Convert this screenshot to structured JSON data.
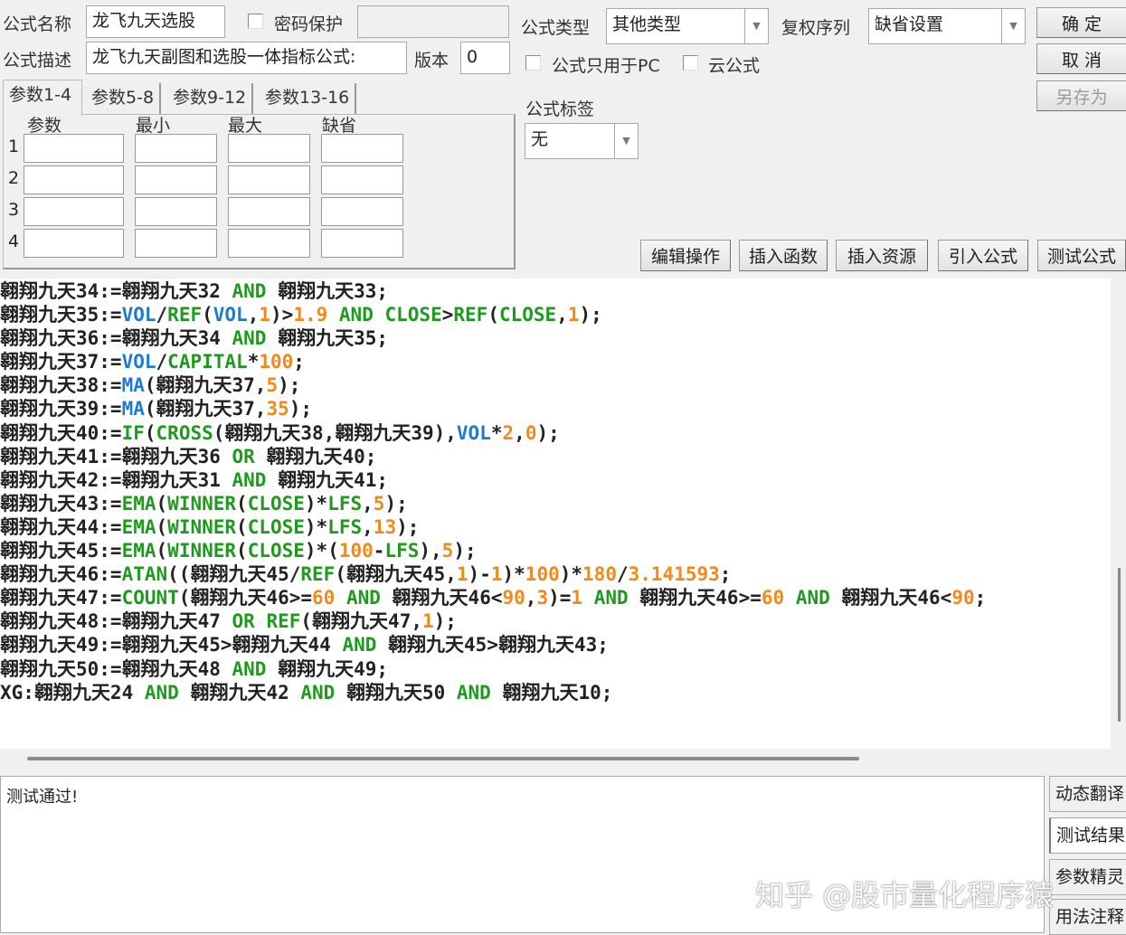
{
  "form": {
    "name_label": "公式名称",
    "name_value": "龙飞九天选股",
    "password_label": "密码保护",
    "desc_label": "公式描述",
    "desc_value": "龙飞九天副图和选股一体指标公式:",
    "version_label": "版本",
    "version_value": "0",
    "type_label": "公式类型",
    "type_value": "其他类型",
    "rights_label": "复权序列",
    "rights_value": "缺省设置",
    "pc_only_label": "公式只用于PC",
    "cloud_label": "云公式",
    "tag_label": "公式标签",
    "tag_value": "无"
  },
  "buttons": {
    "ok": "确 定",
    "cancel": "取 消",
    "save_as": "另存为"
  },
  "tabs": [
    "参数1-4",
    "参数5-8",
    "参数9-12",
    "参数13-16"
  ],
  "param_headers": [
    "参数",
    "最小",
    "最大",
    "缺省"
  ],
  "param_rows": [
    "1",
    "2",
    "3",
    "4"
  ],
  "toolbar": [
    "编辑操作",
    "插入函数",
    "插入资源",
    "引入公式",
    "测试公式"
  ],
  "code_lines": [
    "翱翔九天34:=翱翔九天32 [k|AND] 翱翔九天33;",
    "翱翔九天35:=[b|VOL]/[k|REF]([b|VOL],[n|1])>[n|1.9] [k|AND] [k|CLOSE]>[k|REF]([k|CLOSE],[n|1]);",
    "翱翔九天36:=翱翔九天34 [k|AND] 翱翔九天35;",
    "翱翔九天37:=[b|VOL]/[k|CAPITAL]*[n|100];",
    "翱翔九天38:=[b|MA](翱翔九天37,[n|5]);",
    "翱翔九天39:=[b|MA](翱翔九天37,[n|35]);",
    "翱翔九天40:=[k|IF]([k|CROSS](翱翔九天38,翱翔九天39),[b|VOL]*[n|2],[n|0]);",
    "翱翔九天41:=翱翔九天36 [k|OR] 翱翔九天40;",
    "翱翔九天42:=翱翔九天31 [k|AND] 翱翔九天41;",
    "翱翔九天43:=[k|EMA]([k|WINNER]([k|CLOSE])*[k|LFS],[n|5]);",
    "翱翔九天44:=[k|EMA]([k|WINNER]([k|CLOSE])*[k|LFS],[n|13]);",
    "翱翔九天45:=[k|EMA]([k|WINNER]([k|CLOSE])*([n|100]-[k|LFS]),[n|5]);",
    "翱翔九天46:=[k|ATAN]((翱翔九天45/[k|REF](翱翔九天45,[n|1])-[n|1])*[n|100])*[n|180]/[n|3.141593];",
    "翱翔九天47:=[k|COUNT](翱翔九天46>=[n|60] [k|AND] 翱翔九天46<[n|90],[n|3])=[n|1] [k|AND] 翱翔九天46>=[n|60] [k|AND] 翱翔九天46<[n|90];",
    "翱翔九天48:=翱翔九天47 [k|OR] [k|REF](翱翔九天47,[n|1]);",
    "翱翔九天49:=翱翔九天45>翱翔九天44 [k|AND] 翱翔九天45>翱翔九天43;",
    "翱翔九天50:=翱翔九天48 [k|AND] 翱翔九天49;",
    "XG:翱翔九天24 [k|AND] 翱翔九天42 [k|AND] 翱翔九天50 [k|AND] 翱翔九天10;"
  ],
  "syntax_colors": {
    "keyword": "#1f9a1f",
    "variable": "#1e7ad0",
    "number": "#f08a1c"
  },
  "output_text": "测试通过!",
  "side_buttons": [
    "动态翻译",
    "测试结果",
    "参数精灵",
    "用法注释"
  ],
  "watermark": "知乎 @股市量化程序猿"
}
